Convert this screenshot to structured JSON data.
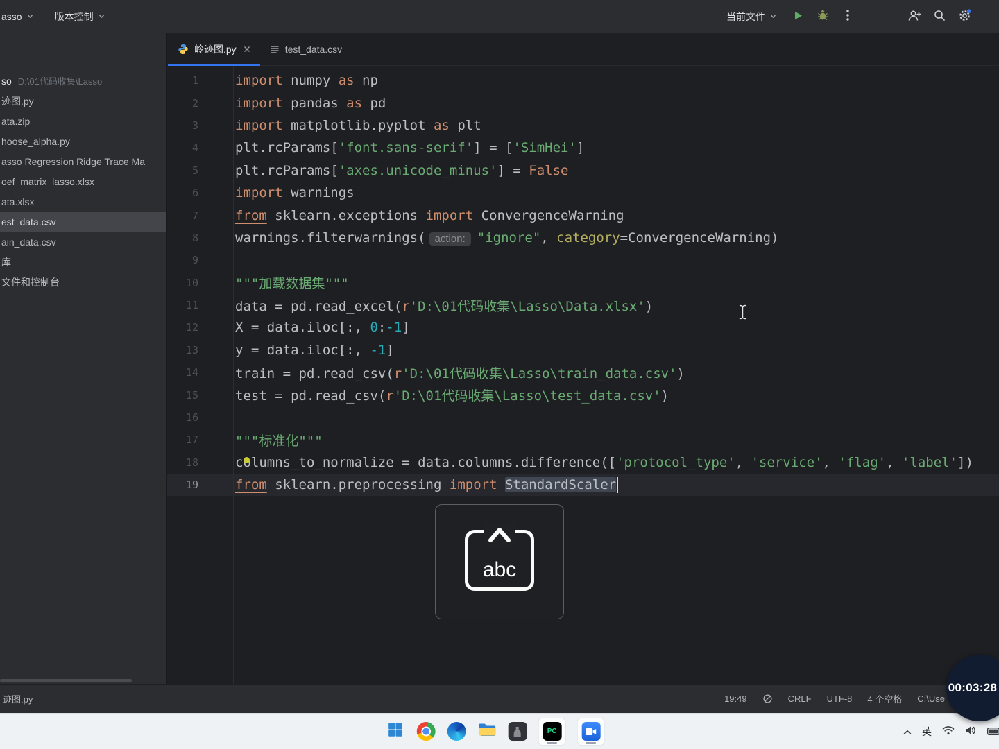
{
  "toolbar": {
    "project_name": "asso",
    "vcs_label": "版本控制",
    "run_config_label": "当前文件"
  },
  "project_panel": {
    "root": {
      "name": "so",
      "path": "D:\\01代码收集\\Lasso"
    },
    "items": [
      {
        "label": "迹图.py"
      },
      {
        "label": "ata.zip"
      },
      {
        "label": "hoose_alpha.py"
      },
      {
        "label": "asso Regression Ridge Trace Ma"
      },
      {
        "label": "oef_matrix_lasso.xlsx"
      },
      {
        "label": "ata.xlsx"
      },
      {
        "label": "est_data.csv",
        "selected": true
      },
      {
        "label": "ain_data.csv"
      },
      {
        "label": "库"
      },
      {
        "label": "文件和控制台"
      }
    ]
  },
  "tabs": [
    {
      "label": "岭迹图.py",
      "icon": "python",
      "active": true,
      "closable": true
    },
    {
      "label": "test_data.csv",
      "icon": "csv",
      "active": false,
      "closable": false
    }
  ],
  "editor": {
    "current_line": 19,
    "lines": [
      {
        "n": 1,
        "seg": [
          [
            "import",
            "kw"
          ],
          [
            " numpy ",
            "txt"
          ],
          [
            "as",
            "kw"
          ],
          [
            " np",
            "txt"
          ]
        ]
      },
      {
        "n": 2,
        "seg": [
          [
            "import",
            "kw"
          ],
          [
            " pandas ",
            "txt"
          ],
          [
            "as",
            "kw"
          ],
          [
            " pd",
            "txt"
          ]
        ]
      },
      {
        "n": 3,
        "seg": [
          [
            "import",
            "kw"
          ],
          [
            " matplotlib.pyplot ",
            "txt"
          ],
          [
            "as",
            "kw"
          ],
          [
            " plt",
            "txt"
          ]
        ]
      },
      {
        "n": 4,
        "seg": [
          [
            "plt.rcParams[",
            "txt"
          ],
          [
            "'font.sans-serif'",
            "str"
          ],
          [
            "] = [",
            "txt"
          ],
          [
            "'SimHei'",
            "str"
          ],
          [
            "]",
            "txt"
          ]
        ]
      },
      {
        "n": 5,
        "seg": [
          [
            "plt.rcParams[",
            "txt"
          ],
          [
            "'axes.unicode_minus'",
            "str"
          ],
          [
            "] = ",
            "txt"
          ],
          [
            "False",
            "kw"
          ]
        ]
      },
      {
        "n": 6,
        "seg": [
          [
            "import",
            "kw"
          ],
          [
            " warnings",
            "txt"
          ]
        ]
      },
      {
        "n": 7,
        "seg": [
          [
            "from",
            "kw u"
          ],
          [
            " sklearn.exceptions ",
            "txt"
          ],
          [
            "import",
            "kw"
          ],
          [
            " ConvergenceWarning",
            "txt"
          ]
        ]
      },
      {
        "n": 8,
        "seg": [
          [
            "warnings.filterwarnings(",
            "txt"
          ],
          [
            "action:",
            "hint"
          ],
          [
            "\"ignore\"",
            "str"
          ],
          [
            ", ",
            "txt"
          ],
          [
            "category",
            "named"
          ],
          [
            "=ConvergenceWarning)",
            "txt"
          ]
        ]
      },
      {
        "n": 9,
        "seg": []
      },
      {
        "n": 10,
        "seg": [
          [
            "\"\"\"加载数据集\"\"\"",
            "str"
          ]
        ]
      },
      {
        "n": 11,
        "seg": [
          [
            "data = pd.read_excel(",
            "txt"
          ],
          [
            "r",
            "raw"
          ],
          [
            "'D:\\01代码收集\\Lasso\\Data.xlsx'",
            "str"
          ],
          [
            ")",
            "txt"
          ]
        ]
      },
      {
        "n": 12,
        "seg": [
          [
            "X = data.iloc[:, ",
            "txt"
          ],
          [
            "0",
            "num"
          ],
          [
            ":",
            "txt"
          ],
          [
            "-1",
            "num"
          ],
          [
            "]",
            "txt"
          ]
        ]
      },
      {
        "n": 13,
        "seg": [
          [
            "y = data.iloc[:, ",
            "txt"
          ],
          [
            "-1",
            "num"
          ],
          [
            "]",
            "txt"
          ]
        ]
      },
      {
        "n": 14,
        "seg": [
          [
            "train = pd.read_csv(",
            "txt"
          ],
          [
            "r",
            "raw"
          ],
          [
            "'D:\\01代码收集\\Lasso\\train_data.csv'",
            "str"
          ],
          [
            ")",
            "txt"
          ]
        ]
      },
      {
        "n": 15,
        "seg": [
          [
            "test = pd.read_csv(",
            "txt"
          ],
          [
            "r",
            "raw"
          ],
          [
            "'D:\\01代码收集\\Lasso\\test_data.csv'",
            "str"
          ],
          [
            ")",
            "txt"
          ]
        ]
      },
      {
        "n": 16,
        "seg": []
      },
      {
        "n": 17,
        "seg": [
          [
            "\"\"\"标准化\"\"\"",
            "str"
          ]
        ]
      },
      {
        "n": 18,
        "seg": [
          [
            "c",
            "txt"
          ],
          [
            "o",
            "txt dot"
          ],
          [
            "lumns_to_normalize = data.columns.difference([",
            "txt"
          ],
          [
            "'protocol_type'",
            "str"
          ],
          [
            ", ",
            "txt"
          ],
          [
            "'service'",
            "str"
          ],
          [
            ", ",
            "txt"
          ],
          [
            "'flag'",
            "str"
          ],
          [
            ", ",
            "txt"
          ],
          [
            "'label'",
            "str"
          ],
          [
            "])",
            "txt"
          ]
        ]
      },
      {
        "n": 19,
        "seg": [
          [
            "from",
            "kw u"
          ],
          [
            " sklearn.preprocessing ",
            "txt"
          ],
          [
            "import",
            "kw"
          ],
          [
            " ",
            "txt"
          ],
          [
            "StandardScaler",
            "txt sel"
          ],
          [
            "",
            "caret"
          ]
        ]
      }
    ]
  },
  "ime_osd": {
    "key_label": "abc"
  },
  "status_bar": {
    "left_file": "迹图.py",
    "cursor_pos": "19:49",
    "line_ending": "CRLF",
    "encoding": "UTF-8",
    "indent": "4 个空格",
    "interpreter": "C:\\Use"
  },
  "recorder_timer": "00:03:28",
  "taskbar": {
    "ime_lang": "英"
  },
  "colors": {
    "accent": "#3574f0",
    "run_green": "#5fad65",
    "keyword": "#cf8e6d",
    "string": "#6aab73",
    "number": "#2aacb8"
  }
}
